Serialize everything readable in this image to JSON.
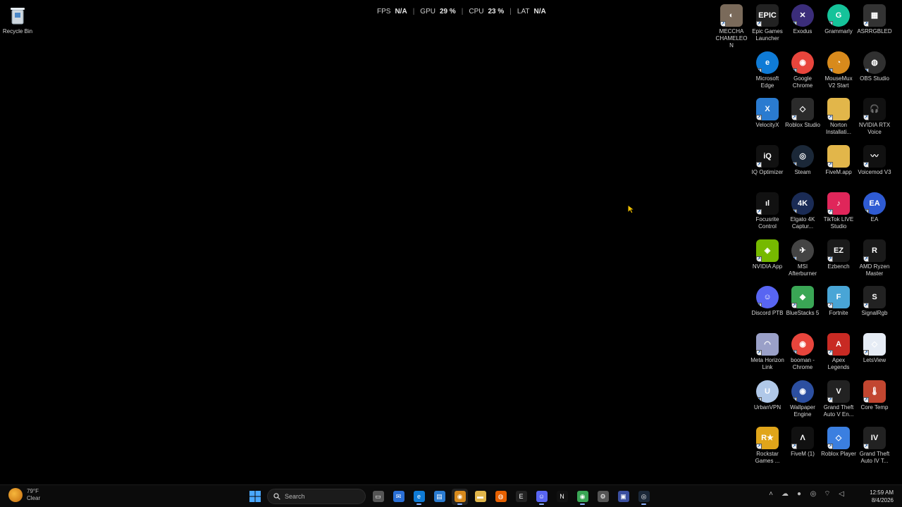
{
  "overlay": {
    "fps_label": "FPS",
    "fps_value": "N/A",
    "gpu_label": "GPU",
    "gpu_value": "29 %",
    "cpu_label": "CPU",
    "cpu_value": "23 %",
    "lat_label": "LAT",
    "lat_value": "N/A",
    "separator": "|"
  },
  "recycle_bin": {
    "label": "Recycle Bin",
    "icon": "recycle-bin-icon"
  },
  "desktop_icons": [
    {
      "label": "MECCHA CHAMELEON",
      "icon": "meccha-chameleon-icon"
    },
    {
      "label": "Epic Games Launcher",
      "icon": "epic-games-icon"
    },
    {
      "label": "Exodus",
      "icon": "exodus-icon"
    },
    {
      "label": "Grammarly",
      "icon": "grammarly-icon"
    },
    {
      "label": "ASRRGBLED",
      "icon": "asrock-rgb-icon"
    },
    {
      "label": "Microsoft Edge",
      "icon": "edge-icon"
    },
    {
      "label": "Google Chrome",
      "icon": "chrome-icon"
    },
    {
      "label": "MouseMux V2 Start",
      "icon": "mousemux-icon"
    },
    {
      "label": "OBS Studio",
      "icon": "obs-icon"
    },
    {
      "label": "VelocityX",
      "icon": "velocityx-icon"
    },
    {
      "label": "Roblox Studio",
      "icon": "roblox-studio-icon"
    },
    {
      "label": "Norton Installati...",
      "icon": "folder-icon"
    },
    {
      "label": "NVIDIA RTX Voice",
      "icon": "nvidia-rtx-voice-icon"
    },
    {
      "label": "IQ Optimizer",
      "icon": "iq-optimizer-icon"
    },
    {
      "label": "Steam",
      "icon": "steam-icon"
    },
    {
      "label": "FiveM.app",
      "icon": "folder-icon"
    },
    {
      "label": "Voicemod V3",
      "icon": "voicemod-icon"
    },
    {
      "label": "Focusrite Control",
      "icon": "focusrite-icon"
    },
    {
      "label": "Elgato 4K Captur...",
      "icon": "elgato-4k-icon"
    },
    {
      "label": "TikTok LIVE Studio",
      "icon": "tiktok-icon"
    },
    {
      "label": "EA",
      "icon": "ea-icon"
    },
    {
      "label": "NVIDIA App",
      "icon": "nvidia-app-icon"
    },
    {
      "label": "MSI Afterburner",
      "icon": "msi-afterburner-icon"
    },
    {
      "label": "Ezbench",
      "icon": "ezbench-icon"
    },
    {
      "label": "AMD Ryzen Master",
      "icon": "amd-ryzen-icon"
    },
    {
      "label": "Discord PTB",
      "icon": "discord-icon"
    },
    {
      "label": "BlueStacks 5",
      "icon": "bluestacks-icon"
    },
    {
      "label": "Fortnite",
      "icon": "fortnite-icon"
    },
    {
      "label": "SignalRgb",
      "icon": "signalrgb-icon"
    },
    {
      "label": "Meta Horizon Link",
      "icon": "meta-horizon-icon"
    },
    {
      "label": "booman - Chrome",
      "icon": "chrome-icon"
    },
    {
      "label": "Apex Legends",
      "icon": "apex-legends-icon"
    },
    {
      "label": "LetsView",
      "icon": "letsview-icon"
    },
    {
      "label": "UrbanVPN",
      "icon": "urbanvpn-icon"
    },
    {
      "label": "Wallpaper Engine",
      "icon": "wallpaper-engine-icon"
    },
    {
      "label": "Grand Theft Auto V En...",
      "icon": "gta-v-icon"
    },
    {
      "label": "Core Temp",
      "icon": "core-temp-icon"
    },
    {
      "label": "Rockstar Games ...",
      "icon": "rockstar-icon"
    },
    {
      "label": "FiveM (1)",
      "icon": "fivem-icon"
    },
    {
      "label": "Roblox Player",
      "icon": "roblox-player-icon"
    },
    {
      "label": "Grand Theft Auto IV T...",
      "icon": "gta-iv-icon"
    }
  ],
  "taskbar": {
    "weather_temp": "79°F",
    "weather_desc": "Clear",
    "search_placeholder": "Search",
    "time": "12:59 AM",
    "date": "8/4/2026",
    "apps": [
      "task-view-icon",
      "mail-icon",
      "edge-icon",
      "store-icon",
      "chrome-canary-icon",
      "file-explorer-icon",
      "firefox-icon",
      "epic-games-icon",
      "discord-icon",
      "netflix-icon",
      "chrome-icon",
      "settings-icon",
      "app-icon",
      "steam-icon"
    ]
  },
  "colors": {
    "desktop_bg": "#000000",
    "taskbar_bg": "#0b0b0b"
  }
}
